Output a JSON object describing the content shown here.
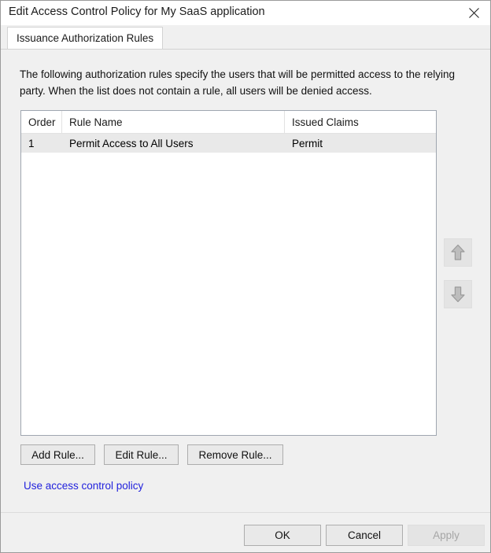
{
  "window": {
    "title": "Edit Access Control Policy for My SaaS application",
    "close_icon": "close-x-icon"
  },
  "tabs": [
    {
      "label": "Issuance Authorization Rules",
      "selected": true
    }
  ],
  "main": {
    "description": "The following authorization rules specify the users that will be permitted access to the relying party. When the list does not contain a rule, all users will be denied access.",
    "list": {
      "columns": [
        "Order",
        "Rule Name",
        "Issued Claims"
      ],
      "rows": [
        {
          "order": "1",
          "rule_name": "Permit Access to All Users",
          "issued_claims": "Permit"
        }
      ]
    },
    "reorder": {
      "move_up_icon": "arrow-up-icon",
      "move_down_icon": "arrow-down-icon",
      "move_up_enabled": false,
      "move_down_enabled": false
    },
    "rule_buttons": {
      "add": "Add Rule...",
      "edit": "Edit Rule...",
      "remove": "Remove Rule..."
    },
    "link": {
      "label": "Use access control policy",
      "color": "#2222dd"
    }
  },
  "footer": {
    "ok": "OK",
    "cancel": "Cancel",
    "apply": "Apply",
    "apply_enabled": false
  }
}
